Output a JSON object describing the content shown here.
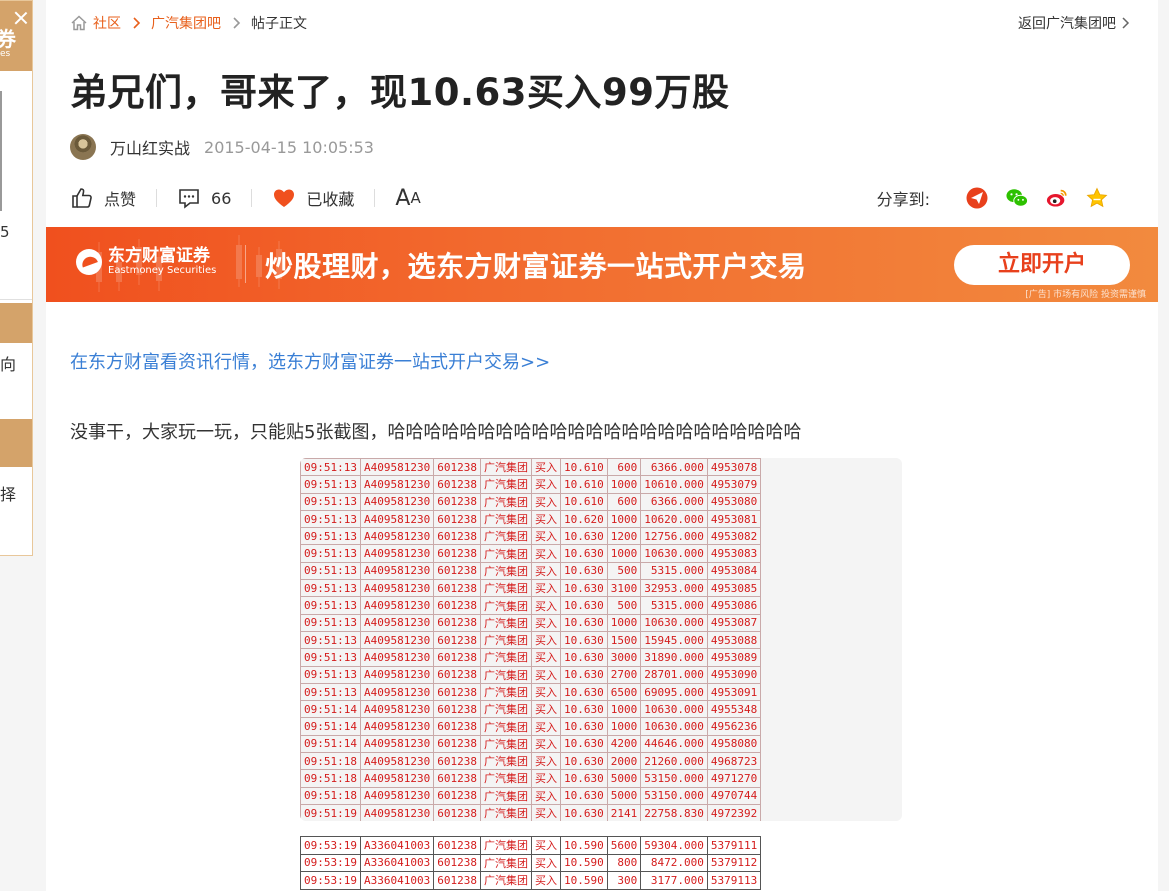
{
  "left_panel": {
    "header_partial": "券",
    "header_sub_partial": "es",
    "side_number": "5",
    "band1_text": "",
    "text_xiang": "向",
    "text_ze": "择"
  },
  "breadcrumb": {
    "items": [
      "社区",
      "广汽集团吧"
    ],
    "current": "帖子正文"
  },
  "back_link": "返回广汽集团吧",
  "post": {
    "title": "弟兄们，哥来了，现10.63买入99万股",
    "author": "万山红实战",
    "time": "2015-04-15 10:05:53",
    "promo_link": "在东方财富看资讯行情，选东方财富证券一站式开户交易>>",
    "body": "没事干，大家玩一玩，只能贴5张截图，哈哈哈哈哈哈哈哈哈哈哈哈哈哈哈哈哈哈哈哈哈哈哈"
  },
  "actions": {
    "like_label": "点赞",
    "comment_count": "66",
    "favorite_label": "已收藏",
    "font_big": "A",
    "font_small": "A",
    "share_label": "分享到:"
  },
  "ad": {
    "brand": "东方财富证券",
    "brand_en": "Eastmoney Securities",
    "slogan": "炒股理财，选东方财富证券一站式开户交易",
    "button": "立即开户",
    "risk": "[广告] 市场有风险 投资需谨慎"
  },
  "colors": {
    "accent": "#e8601c",
    "link": "#3a7fd5",
    "trade_red": "#d41c1c"
  },
  "trades1": [
    [
      "09:51:13",
      "A409581230",
      "601238",
      "广汽集团",
      "买入",
      "10.610",
      "600",
      "6366.000",
      "4953078"
    ],
    [
      "09:51:13",
      "A409581230",
      "601238",
      "广汽集团",
      "买入",
      "10.610",
      "1000",
      "10610.000",
      "4953079"
    ],
    [
      "09:51:13",
      "A409581230",
      "601238",
      "广汽集团",
      "买入",
      "10.610",
      "600",
      "6366.000",
      "4953080"
    ],
    [
      "09:51:13",
      "A409581230",
      "601238",
      "广汽集团",
      "买入",
      "10.620",
      "1000",
      "10620.000",
      "4953081"
    ],
    [
      "09:51:13",
      "A409581230",
      "601238",
      "广汽集团",
      "买入",
      "10.630",
      "1200",
      "12756.000",
      "4953082"
    ],
    [
      "09:51:13",
      "A409581230",
      "601238",
      "广汽集团",
      "买入",
      "10.630",
      "1000",
      "10630.000",
      "4953083"
    ],
    [
      "09:51:13",
      "A409581230",
      "601238",
      "广汽集团",
      "买入",
      "10.630",
      "500",
      "5315.000",
      "4953084"
    ],
    [
      "09:51:13",
      "A409581230",
      "601238",
      "广汽集团",
      "买入",
      "10.630",
      "3100",
      "32953.000",
      "4953085"
    ],
    [
      "09:51:13",
      "A409581230",
      "601238",
      "广汽集团",
      "买入",
      "10.630",
      "500",
      "5315.000",
      "4953086"
    ],
    [
      "09:51:13",
      "A409581230",
      "601238",
      "广汽集团",
      "买入",
      "10.630",
      "1000",
      "10630.000",
      "4953087"
    ],
    [
      "09:51:13",
      "A409581230",
      "601238",
      "广汽集团",
      "买入",
      "10.630",
      "1500",
      "15945.000",
      "4953088"
    ],
    [
      "09:51:13",
      "A409581230",
      "601238",
      "广汽集团",
      "买入",
      "10.630",
      "3000",
      "31890.000",
      "4953089"
    ],
    [
      "09:51:13",
      "A409581230",
      "601238",
      "广汽集团",
      "买入",
      "10.630",
      "2700",
      "28701.000",
      "4953090"
    ],
    [
      "09:51:13",
      "A409581230",
      "601238",
      "广汽集团",
      "买入",
      "10.630",
      "6500",
      "69095.000",
      "4953091"
    ],
    [
      "09:51:14",
      "A409581230",
      "601238",
      "广汽集团",
      "买入",
      "10.630",
      "1000",
      "10630.000",
      "4955348"
    ],
    [
      "09:51:14",
      "A409581230",
      "601238",
      "广汽集团",
      "买入",
      "10.630",
      "1000",
      "10630.000",
      "4956236"
    ],
    [
      "09:51:14",
      "A409581230",
      "601238",
      "广汽集团",
      "买入",
      "10.630",
      "4200",
      "44646.000",
      "4958080"
    ],
    [
      "09:51:18",
      "A409581230",
      "601238",
      "广汽集团",
      "买入",
      "10.630",
      "2000",
      "21260.000",
      "4968723"
    ],
    [
      "09:51:18",
      "A409581230",
      "601238",
      "广汽集团",
      "买入",
      "10.630",
      "5000",
      "53150.000",
      "4971270"
    ],
    [
      "09:51:18",
      "A409581230",
      "601238",
      "广汽集团",
      "买入",
      "10.630",
      "5000",
      "53150.000",
      "4970744"
    ],
    [
      "09:51:19",
      "A409581230",
      "601238",
      "广汽集团",
      "买入",
      "10.630",
      "2141",
      "22758.830",
      "4972392"
    ]
  ],
  "trades2": [
    [
      "09:53:19",
      "A336041003",
      "601238",
      "广汽集团",
      "买入",
      "10.590",
      "5600",
      "59304.000",
      "5379111"
    ],
    [
      "09:53:19",
      "A336041003",
      "601238",
      "广汽集团",
      "买入",
      "10.590",
      "800",
      "8472.000",
      "5379112"
    ],
    [
      "09:53:19",
      "A336041003",
      "601238",
      "广汽集团",
      "买入",
      "10.590",
      "300",
      "3177.000",
      "5379113"
    ]
  ]
}
